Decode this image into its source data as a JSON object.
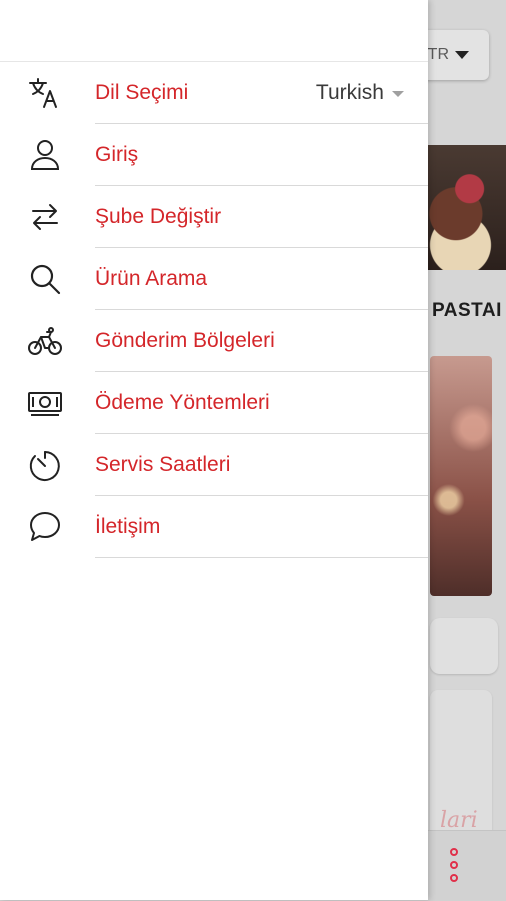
{
  "background": {
    "language_button": "TR",
    "section_title": "PASTAI",
    "script_text": "lari"
  },
  "drawer": {
    "items": [
      {
        "label": "Dil Seçimi",
        "icon": "translate-icon"
      },
      {
        "label": "Giriş",
        "icon": "user-icon"
      },
      {
        "label": "Şube Değiştir",
        "icon": "swap-arrows-icon"
      },
      {
        "label": "Ürün Arama",
        "icon": "search-icon"
      },
      {
        "label": "Gönderim Bölgeleri",
        "icon": "bicycle-icon"
      },
      {
        "label": "Ödeme Yöntemleri",
        "icon": "money-icon"
      },
      {
        "label": "Servis Saatleri",
        "icon": "timer-icon"
      },
      {
        "label": "İletişim",
        "icon": "chat-icon"
      }
    ],
    "language_select": {
      "value": "Turkish"
    }
  },
  "colors": {
    "accent": "#d4262a",
    "drawer_bg": "#ffffff",
    "overlay_bg": "#d6d6d6"
  }
}
